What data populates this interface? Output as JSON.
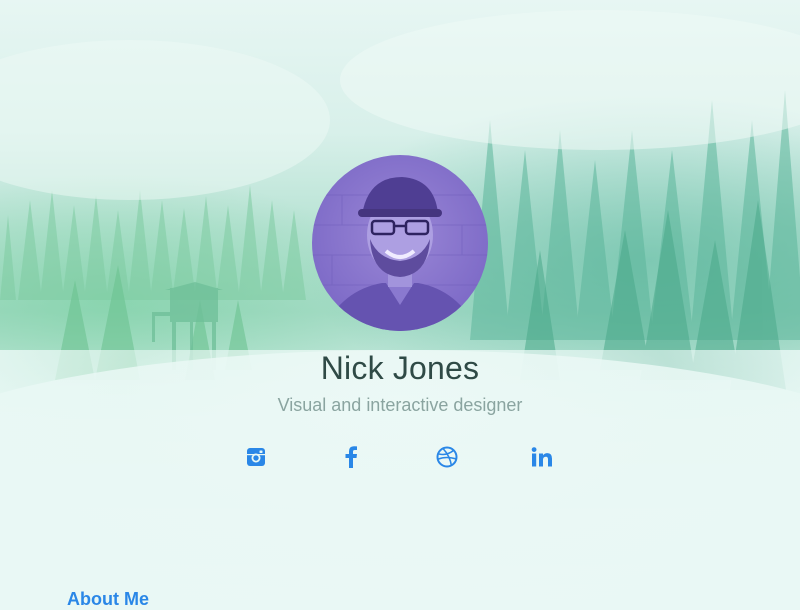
{
  "profile": {
    "name": "Nick Jones",
    "tagline": "Visual and interactive designer",
    "avatar": "profile-photo"
  },
  "social": [
    {
      "network": "Instagram",
      "icon": "instagram-icon"
    },
    {
      "network": "Facebook",
      "icon": "facebook-icon"
    },
    {
      "network": "Dribbble",
      "icon": "dribbble-icon"
    },
    {
      "network": "LinkedIn",
      "icon": "linkedin-icon"
    }
  ],
  "section": {
    "title": "About Me"
  },
  "colors": {
    "accent": "#2a87e7",
    "name_text": "#2f4a46",
    "tagline_text": "#8aa4a0",
    "avatar_tint": "#8270cc"
  }
}
